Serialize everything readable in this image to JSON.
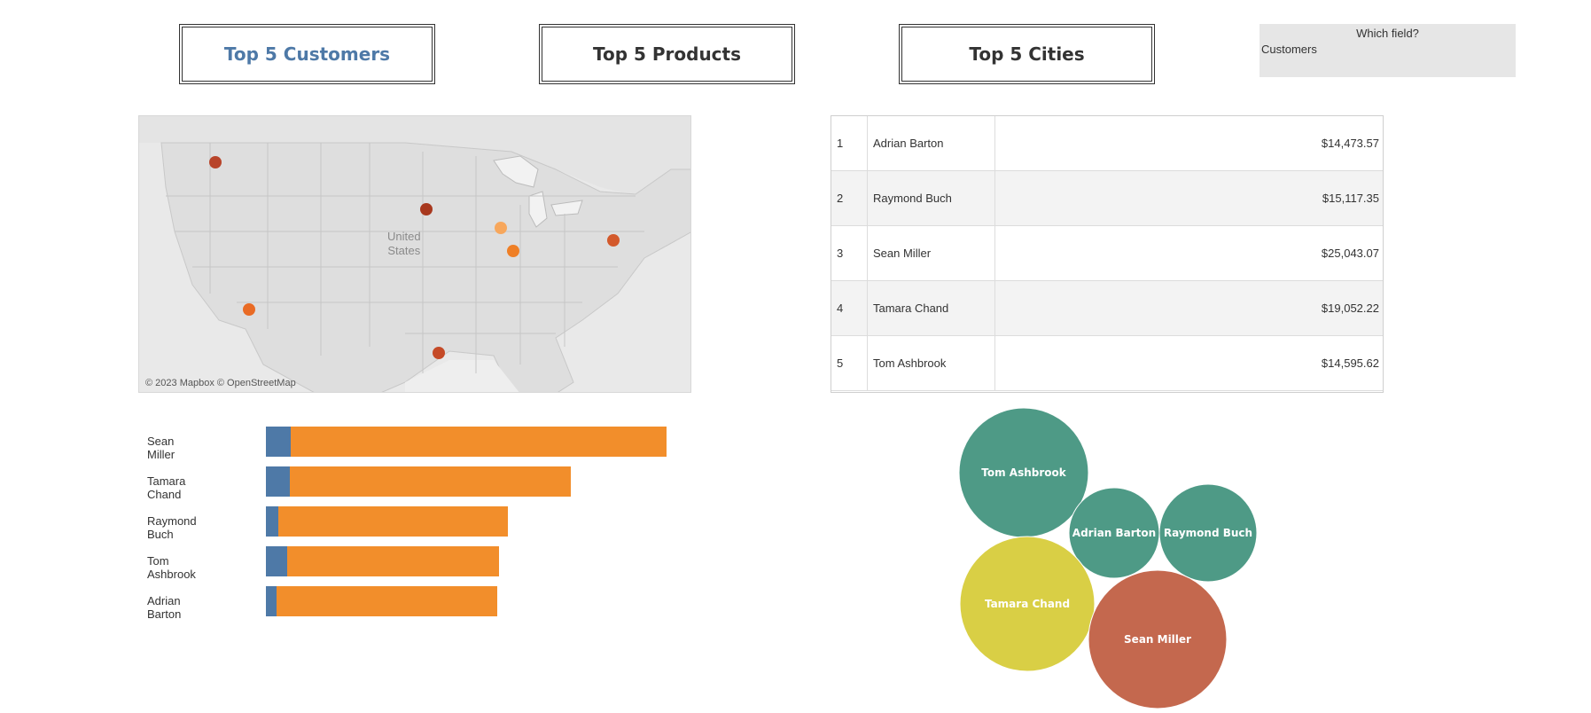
{
  "buttons": {
    "customers": "Top 5 Customers",
    "products": "Top 5 Products",
    "cities": "Top 5 Cities"
  },
  "parameter": {
    "title": "Which field?",
    "value": "Customers"
  },
  "map": {
    "attribution": "© 2023 Mapbox © OpenStreetMap",
    "country_line1": "United",
    "country_line2": "States"
  },
  "table": {
    "rows": [
      {
        "rank": "1",
        "name": "Adrian Barton",
        "value": "$14,473.57"
      },
      {
        "rank": "2",
        "name": "Raymond Buch",
        "value": "$15,117.35"
      },
      {
        "rank": "3",
        "name": "Sean Miller",
        "value": "$25,043.07"
      },
      {
        "rank": "4",
        "name": "Tamara Chand",
        "value": "$19,052.22"
      },
      {
        "rank": "5",
        "name": "Tom Ashbrook",
        "value": "$14,595.62"
      }
    ]
  },
  "chart_data": [
    {
      "type": "bar",
      "orientation": "horizontal",
      "stacked": true,
      "categories": [
        "Sean Miller",
        "Tamara Chand",
        "Raymond Buch",
        "Tom Ashbrook",
        "Adrian Barton"
      ],
      "series": [
        {
          "color": "#4e79a7",
          "values": [
            1530,
            1480,
            780,
            1340,
            650
          ]
        },
        {
          "color": "#f28e2b",
          "values": [
            23513,
            17572,
            14337,
            13256,
            13824
          ]
        }
      ],
      "xlim": [
        0,
        25043
      ]
    },
    {
      "type": "bubble",
      "points": [
        {
          "label": "Tom Ashbrook",
          "color": "#4e9a86"
        },
        {
          "label": "Adrian Barton",
          "color": "#4e9a86"
        },
        {
          "label": "Raymond Buch",
          "color": "#4e9a86"
        },
        {
          "label": "Tamara Chand",
          "color": "#d9cf45"
        },
        {
          "label": "Sean Miller",
          "color": "#c4684e"
        }
      ]
    }
  ]
}
